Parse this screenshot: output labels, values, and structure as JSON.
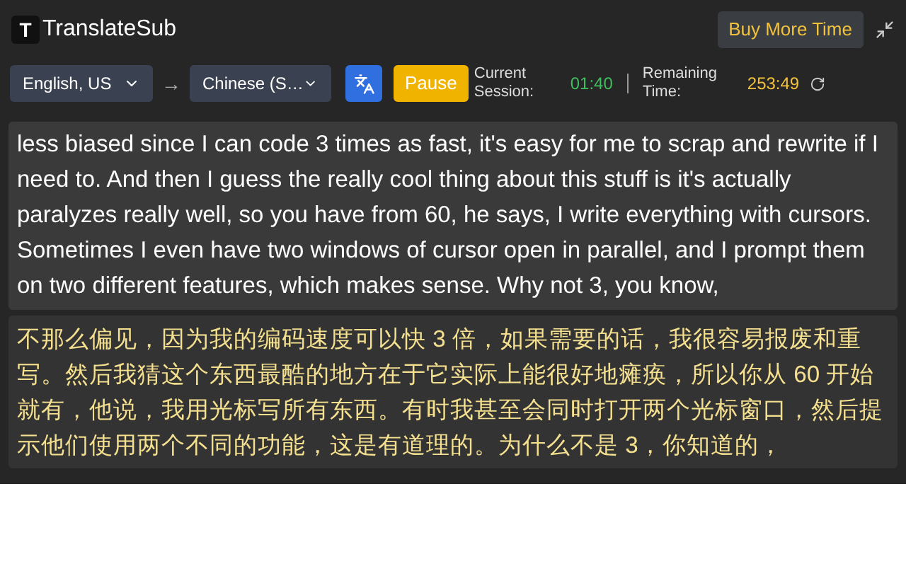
{
  "app": {
    "title": "TranslateSub",
    "logo_letter": "T"
  },
  "header": {
    "buy_button": "Buy More Time"
  },
  "controls": {
    "source_language": "English, US",
    "arrow": "→",
    "target_language": "Chinese (S…",
    "pause_button": "Pause",
    "session_label": "Current Session:",
    "session_time": "01:40",
    "remaining_label": "Remaining Time:",
    "remaining_time": "253:49"
  },
  "transcript": {
    "original": "less biased since I can code 3 times as fast, it's easy for me to scrap and rewrite if I need to. And then I guess the really cool thing about this stuff is it's actually paralyzes really well, so you have from 60, he says, I write everything with cursors. Sometimes I even have two windows of cursor open in parallel, and I prompt them on two different features, which makes sense. Why not 3, you know,",
    "translation": "不那么偏见，因为我的编码速度可以快 3 倍，如果需要的话，我很容易报废和重写。然后我猜这个东西最酷的地方在于它实际上能很好地瘫痪，所以你从 60 开始就有，他说，我用光标写所有东西。有时我甚至会同时打开两个光标窗口，然后提示他们使用两个不同的功能，这是有道理的。为什么不是 3，你知道的，"
  }
}
